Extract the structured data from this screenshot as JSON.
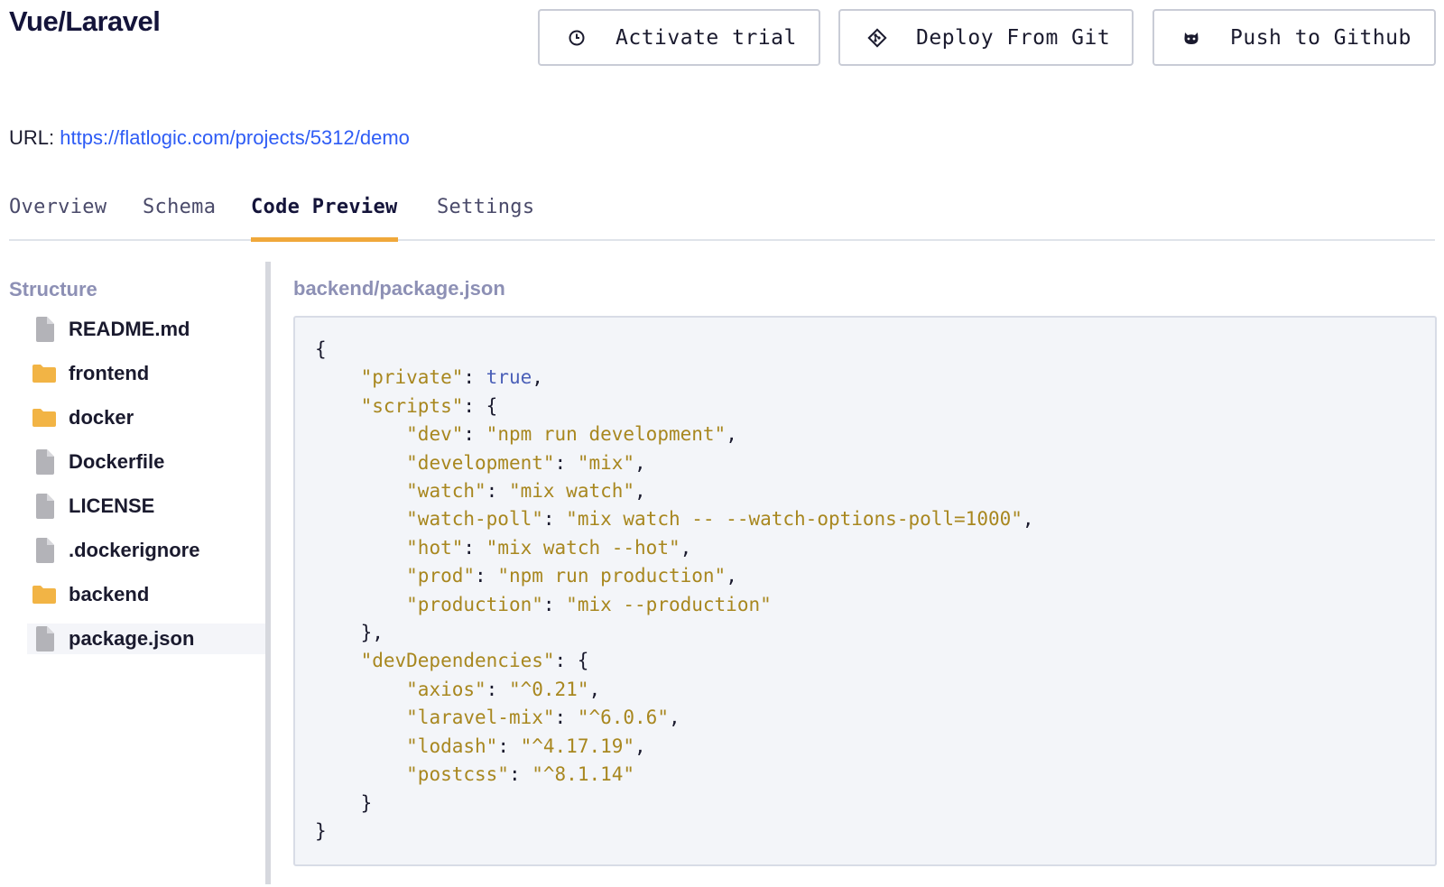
{
  "header": {
    "title": "Vue/Laravel",
    "buttons": {
      "trial": "Activate trial",
      "deploy": "Deploy From Git",
      "push": "Push to Github"
    }
  },
  "url": {
    "label": "URL:",
    "link": "https://flatlogic.com/projects/5312/demo"
  },
  "tabs": [
    {
      "label": "Overview"
    },
    {
      "label": "Schema"
    },
    {
      "label": "Code Preview"
    },
    {
      "label": "Settings"
    }
  ],
  "active_tab": "Code Preview",
  "sidebar": {
    "title": "Structure",
    "items": [
      {
        "name": "README.md",
        "type": "file"
      },
      {
        "name": "frontend",
        "type": "folder"
      },
      {
        "name": "docker",
        "type": "folder"
      },
      {
        "name": "Dockerfile",
        "type": "file"
      },
      {
        "name": "LICENSE",
        "type": "file"
      },
      {
        "name": ".dockerignore",
        "type": "file"
      },
      {
        "name": "backend",
        "type": "folder"
      },
      {
        "name": "package.json",
        "type": "file"
      }
    ],
    "selected": "package.json"
  },
  "editor": {
    "path": "backend/package.json",
    "code": "{\n    \"private\": true,\n    \"scripts\": {\n        \"dev\": \"npm run development\",\n        \"development\": \"mix\",\n        \"watch\": \"mix watch\",\n        \"watch-poll\": \"mix watch -- --watch-options-poll=1000\",\n        \"hot\": \"mix watch --hot\",\n        \"prod\": \"npm run production\",\n        \"production\": \"mix --production\"\n    },\n    \"devDependencies\": {\n        \"axios\": \"^0.21\",\n        \"laravel-mix\": \"^6.0.6\",\n        \"lodash\": \"^4.17.19\",\n        \"postcss\": \"^8.1.14\"\n    }\n}"
  },
  "colors": {
    "accent_tab": "#f0a83a",
    "link": "#2e5cf5",
    "folder": "#f2b445",
    "file": "#b3b3b8",
    "code_string": "#a8871f",
    "code_keyword": "#4a5fb8"
  }
}
